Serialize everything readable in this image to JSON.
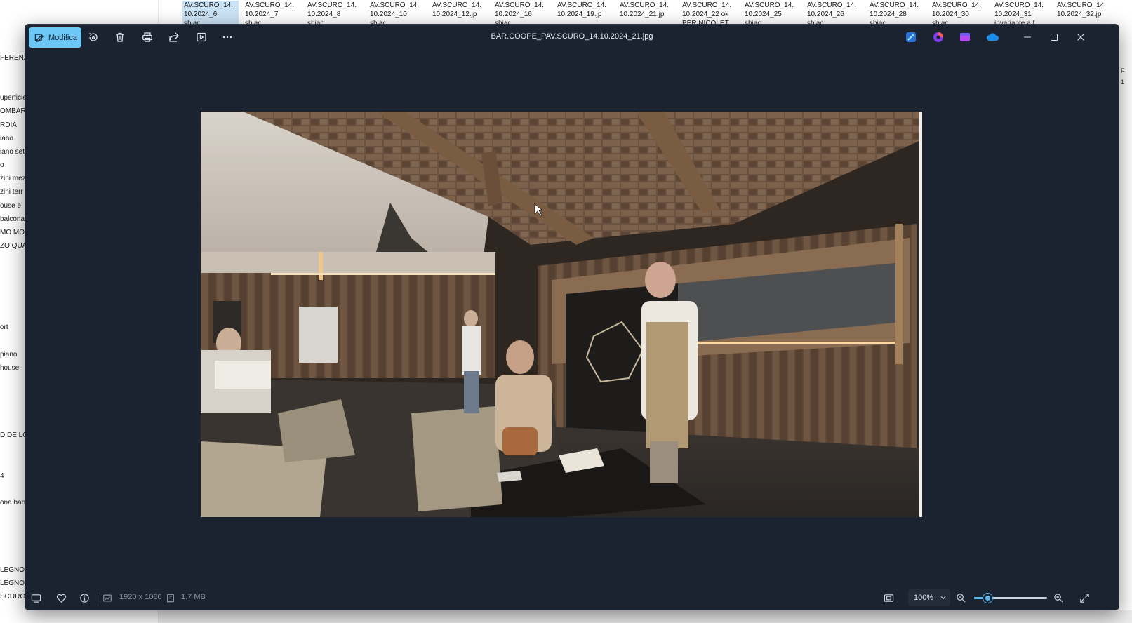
{
  "explorer": {
    "sidebar_fragments": [
      "FERENZ",
      "uperficie",
      "OMBAR",
      "RDIA",
      "iano",
      "iano set",
      "o",
      "zini mez",
      "zini terr",
      "ouse e",
      "balcona",
      "MO MOD",
      "ZO QUA",
      "ort",
      "piano",
      "house",
      "D DE LO",
      "4",
      "ona ban",
      "LEGNO",
      "LEGNO",
      "SCURO"
    ],
    "thumbnails": [
      {
        "line1": "AV.SCURO_14.",
        "line2": "10.2024_6",
        "line3": "shiac",
        "selected": true
      },
      {
        "line1": "AV.SCURO_14.",
        "line2": "10.2024_7",
        "line3": "shiac",
        "selected": false
      },
      {
        "line1": "AV.SCURO_14.",
        "line2": "10.2024_8",
        "line3": "shiac",
        "selected": false
      },
      {
        "line1": "AV.SCURO_14.",
        "line2": "10.2024_10",
        "line3": "shiac",
        "selected": false
      },
      {
        "line1": "AV.SCURO_14.",
        "line2": "10.2024_12.jp",
        "line3": "",
        "selected": false
      },
      {
        "line1": "AV.SCURO_14.",
        "line2": "10.2024_16",
        "line3": "shiac",
        "selected": false
      },
      {
        "line1": "AV.SCURO_14.",
        "line2": "10.2024_19.jp",
        "line3": "",
        "selected": false
      },
      {
        "line1": "AV.SCURO_14.",
        "line2": "10.2024_21.jp",
        "line3": "",
        "selected": false
      },
      {
        "line1": "AV.SCURO_14.",
        "line2": "10.2024_22 ok",
        "line3": "PER NICOLET",
        "selected": false
      },
      {
        "line1": "AV.SCURO_14.",
        "line2": "10.2024_25",
        "line3": "shiac",
        "selected": false
      },
      {
        "line1": "AV.SCURO_14.",
        "line2": "10.2024_26",
        "line3": "shiac",
        "selected": false
      },
      {
        "line1": "AV.SCURO_14.",
        "line2": "10.2024_28",
        "line3": "shiac",
        "selected": false
      },
      {
        "line1": "AV.SCURO_14.",
        "line2": "10.2024_30",
        "line3": "shiac",
        "selected": false
      },
      {
        "line1": "AV.SCURO_14.",
        "line2": "10.2024_31",
        "line3": "invariante a f",
        "selected": false
      },
      {
        "line1": "AV.SCURO_14.",
        "line2": "10.2024_32.jp",
        "line3": "",
        "selected": false
      }
    ],
    "right_fragments": [
      "F",
      "1"
    ]
  },
  "viewer": {
    "edit_label": "Modifica",
    "toolbar_icons": [
      "rotate-icon",
      "delete-icon",
      "print-icon",
      "share-icon",
      "slideshow-icon",
      "more-icon"
    ],
    "title": "BAR.COOPE_PAV.SCURO_14.10.2024_21.jpg",
    "app_icons": [
      "designer-icon",
      "clipchamp-icon",
      "video-editor-icon",
      "onedrive-icon"
    ],
    "window_controls": [
      "minimize",
      "maximize",
      "close"
    ],
    "status": {
      "dimensions": "1920 x 1080",
      "file_size": "1.7 MB",
      "zoom_level": "100%",
      "zoom_slider_fraction": 0.18
    },
    "colors": {
      "window_bg": "#1b2230",
      "accent": "#6cc7f6",
      "slider": "#55b6ee"
    }
  }
}
